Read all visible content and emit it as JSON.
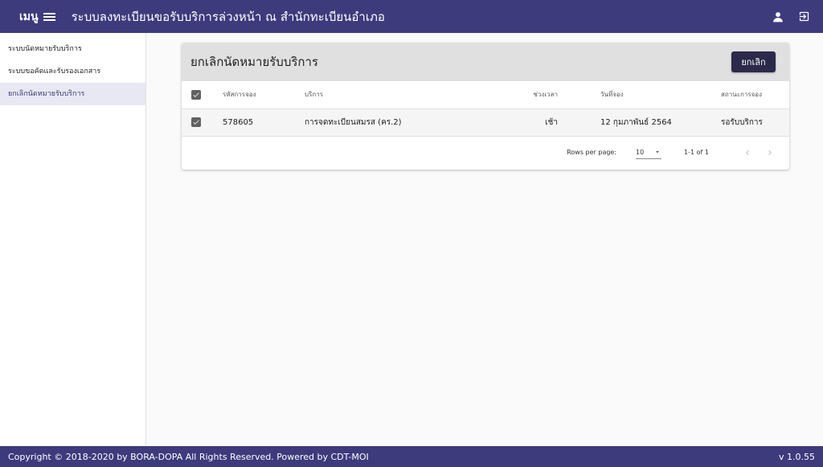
{
  "header": {
    "menu_label": "เมนู",
    "app_title": "ระบบลงทะเบียนขอรับบริการล่วงหน้า ณ สำนักทะเบียนอำเภอ",
    "icons": [
      "account-icon",
      "logout-icon"
    ]
  },
  "sidebar": {
    "items": [
      {
        "label": "ระบบนัดหมายรับบริการ",
        "active": false
      },
      {
        "label": "ระบบขอคัดและรับรองเอกสาร",
        "active": false
      },
      {
        "label": "ยกเลิกนัดหมายรับบริการ",
        "active": true
      }
    ]
  },
  "card": {
    "title": "ยกเลิกนัดหมายรับบริการ",
    "cancel_label": "ยกเลิก"
  },
  "table": {
    "headers": [
      "รหัสการจอง",
      "บริการ",
      "ช่วงเวลา",
      "วันที่จอง",
      "สถานะการจอง"
    ],
    "rows": [
      {
        "selected": true,
        "code": "578605",
        "service": "การจดทะเบียนสมรส (คร.2)",
        "time": "เช้า",
        "date": "12 กุมภาพันธ์ 2564",
        "status": "รอรับบริการ"
      }
    ],
    "header_checked": true
  },
  "pagination": {
    "rows_per_page_label": "Rows per page:",
    "rows_per_page_value": "10",
    "range_text": "1-1 of 1"
  },
  "footer": {
    "copyright": "Copyright © 2018-2020 by BORA-DOPA All Rights Reserved. Powered by CDT-MOI",
    "version": "v 1.0.55"
  },
  "colors": {
    "primary": "#3d3b7c",
    "button_dark": "#2c2a4a",
    "active_bg": "#e8e8f3"
  }
}
